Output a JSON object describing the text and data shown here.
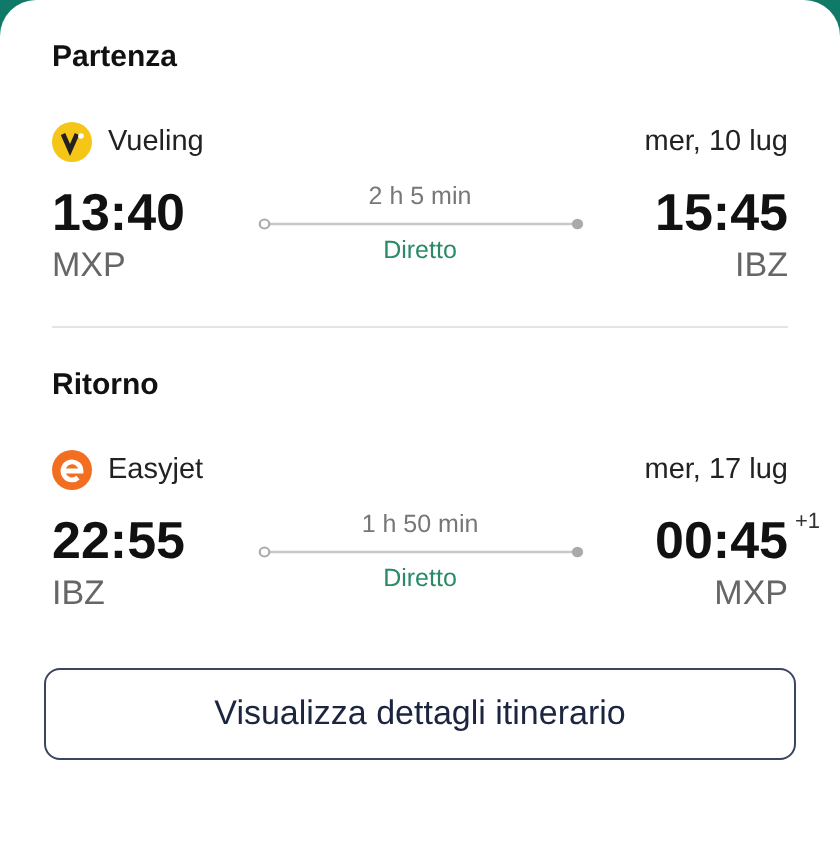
{
  "legs": [
    {
      "title": "Partenza",
      "airline": {
        "name": "Vueling",
        "kind": "vueling"
      },
      "date": "mer, 10 lug",
      "departure": {
        "time": "13:40",
        "airport": "MXP"
      },
      "duration": "2 h 5 min",
      "stops": "Diretto",
      "arrival": {
        "time": "15:45",
        "airport": "IBZ"
      }
    },
    {
      "title": "Ritorno",
      "airline": {
        "name": "Easyjet",
        "kind": "easyjet"
      },
      "date": "mer, 17 lug",
      "departure": {
        "time": "22:55",
        "airport": "IBZ"
      },
      "duration": "1 h 50 min",
      "stops": "Diretto",
      "arrival": {
        "time": "00:45",
        "airport": "MXP",
        "day_offset": "+1"
      }
    }
  ],
  "button": "Visualizza dettagli itinerario"
}
